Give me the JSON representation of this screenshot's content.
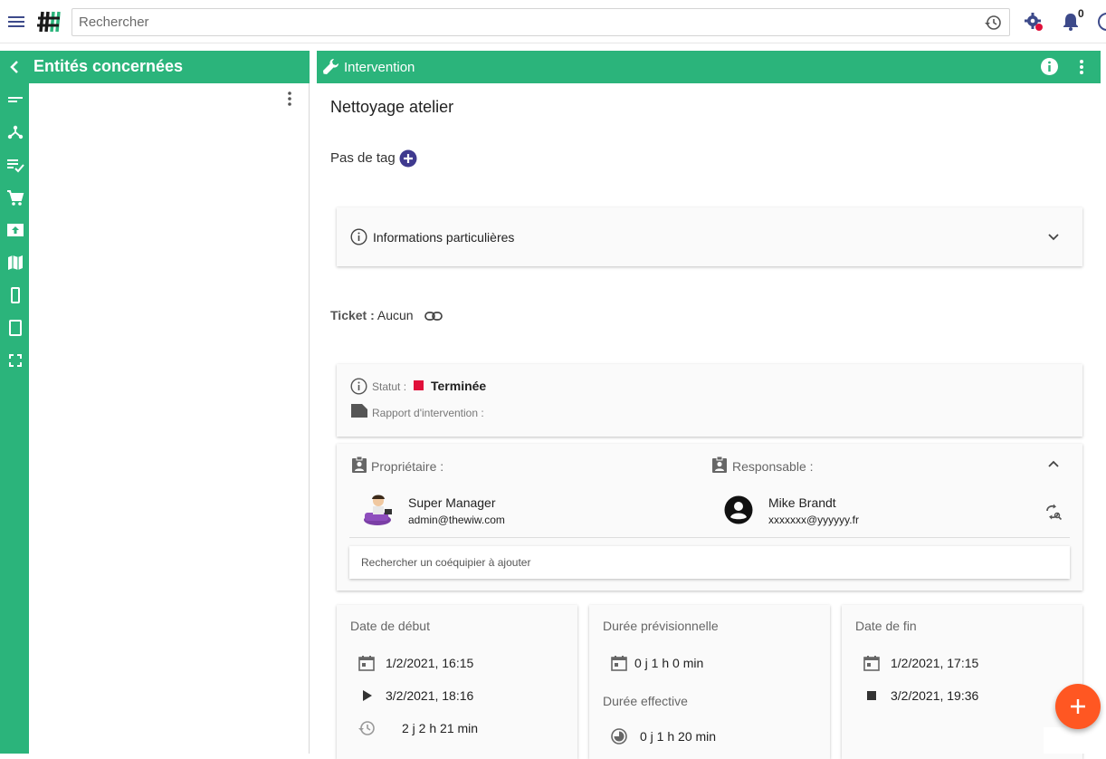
{
  "search": {
    "placeholder": "Rechercher"
  },
  "notifications": {
    "count": "0"
  },
  "left_panel": {
    "title": "Entités concernées"
  },
  "right_panel": {
    "title": "Intervention"
  },
  "intervention": {
    "name": "Nettoyage atelier",
    "tags_label": "Pas de tag",
    "info_section": "Informations particulières",
    "ticket_label": "Ticket :",
    "ticket_value": "Aucun",
    "status_label": "Statut :",
    "status_value": "Terminée",
    "status_color": "#e0103a",
    "report_label": "Rapport d'intervention :"
  },
  "team": {
    "owner_label": "Propriétaire :",
    "owner_name": "Super Manager",
    "owner_email": "admin@thewiw.com",
    "responsible_label": "Responsable :",
    "responsible_name": "Mike Brandt",
    "responsible_email": "xxxxxxx@yyyyyy.fr",
    "search_teammate_placeholder": "Rechercher un coéquipier à ajouter"
  },
  "dates": {
    "start_title": "Date de début",
    "start_planned": "1/2/2021, 16:15",
    "start_actual": "3/2/2021, 18:16",
    "delay": "2 j 2 h 21 min",
    "planned_duration_title": "Durée prévisionnelle",
    "planned_duration": "0 j 1 h 0 min",
    "actual_duration_title": "Durée effective",
    "actual_duration": "0 j 1 h 20 min",
    "end_title": "Date de fin",
    "end_planned": "1/2/2021, 17:15",
    "end_actual": "3/2/2021, 19:36"
  },
  "colors": {
    "accent": "#2bb47b",
    "fab": "#ff5722",
    "tag_add": "#3f3a8f"
  }
}
